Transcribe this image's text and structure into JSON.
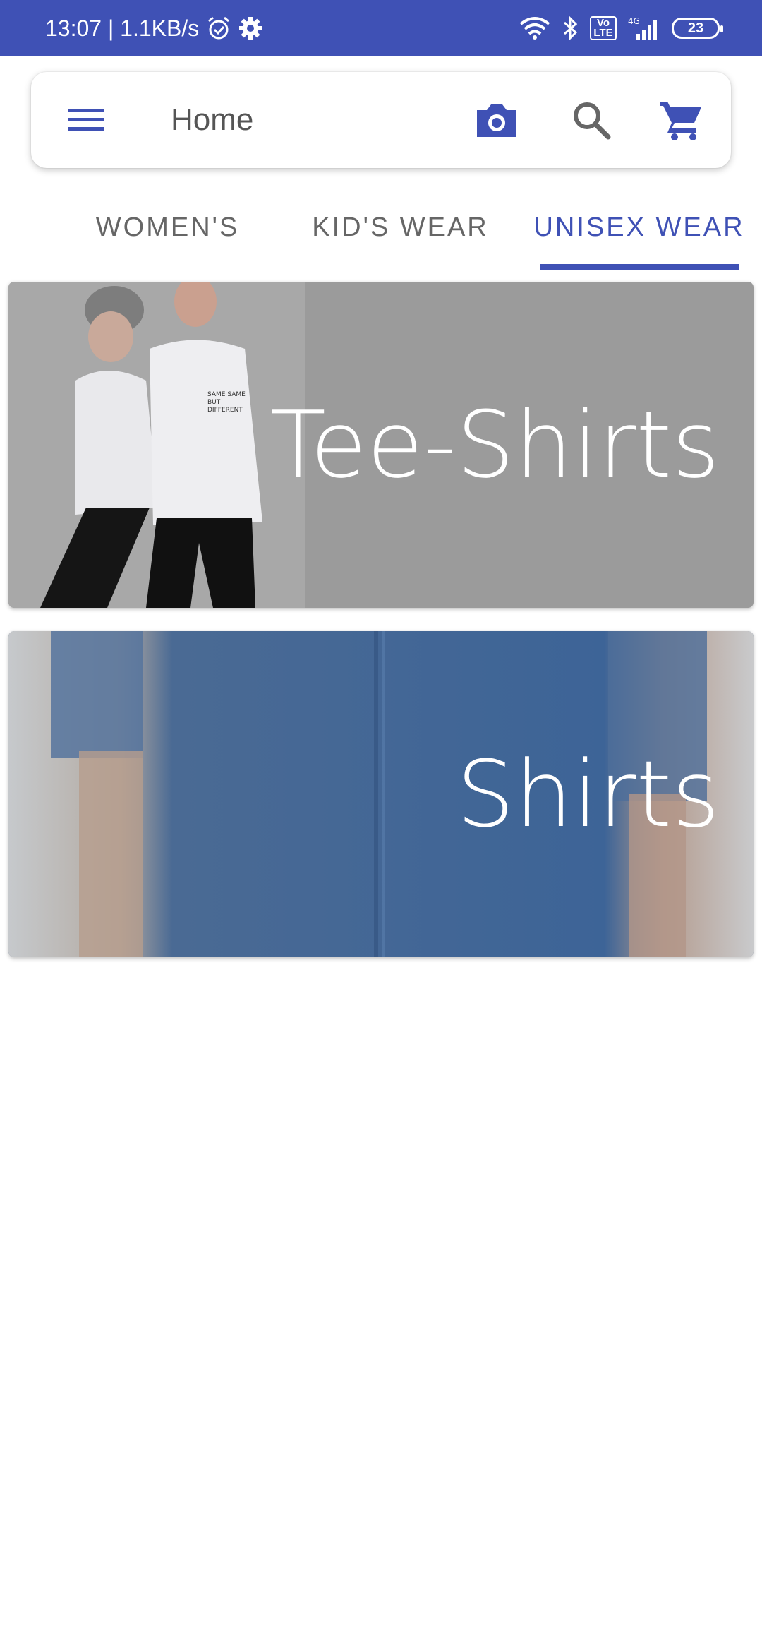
{
  "status_bar": {
    "time_speed": "13:07 | 1.1KB/s",
    "volte": "Vo\nLTE",
    "network": "4G",
    "battery": "23",
    "icons": [
      "alarm-icon",
      "settings-icon",
      "wifi-icon",
      "bluetooth-icon",
      "volte-icon",
      "signal-icon",
      "battery-icon"
    ]
  },
  "app_bar": {
    "title": "Home",
    "icons": [
      "menu-icon",
      "camera-icon",
      "search-icon",
      "cart-icon"
    ],
    "accent_color": "#3f51b5"
  },
  "tabs": [
    {
      "label": "WOMEN'S",
      "active": false
    },
    {
      "label": "KID'S WEAR",
      "active": false
    },
    {
      "label": "UNISEX WEAR",
      "active": true
    }
  ],
  "categories": [
    {
      "label": "Tee-Shirts"
    },
    {
      "label": "Shirts"
    }
  ]
}
